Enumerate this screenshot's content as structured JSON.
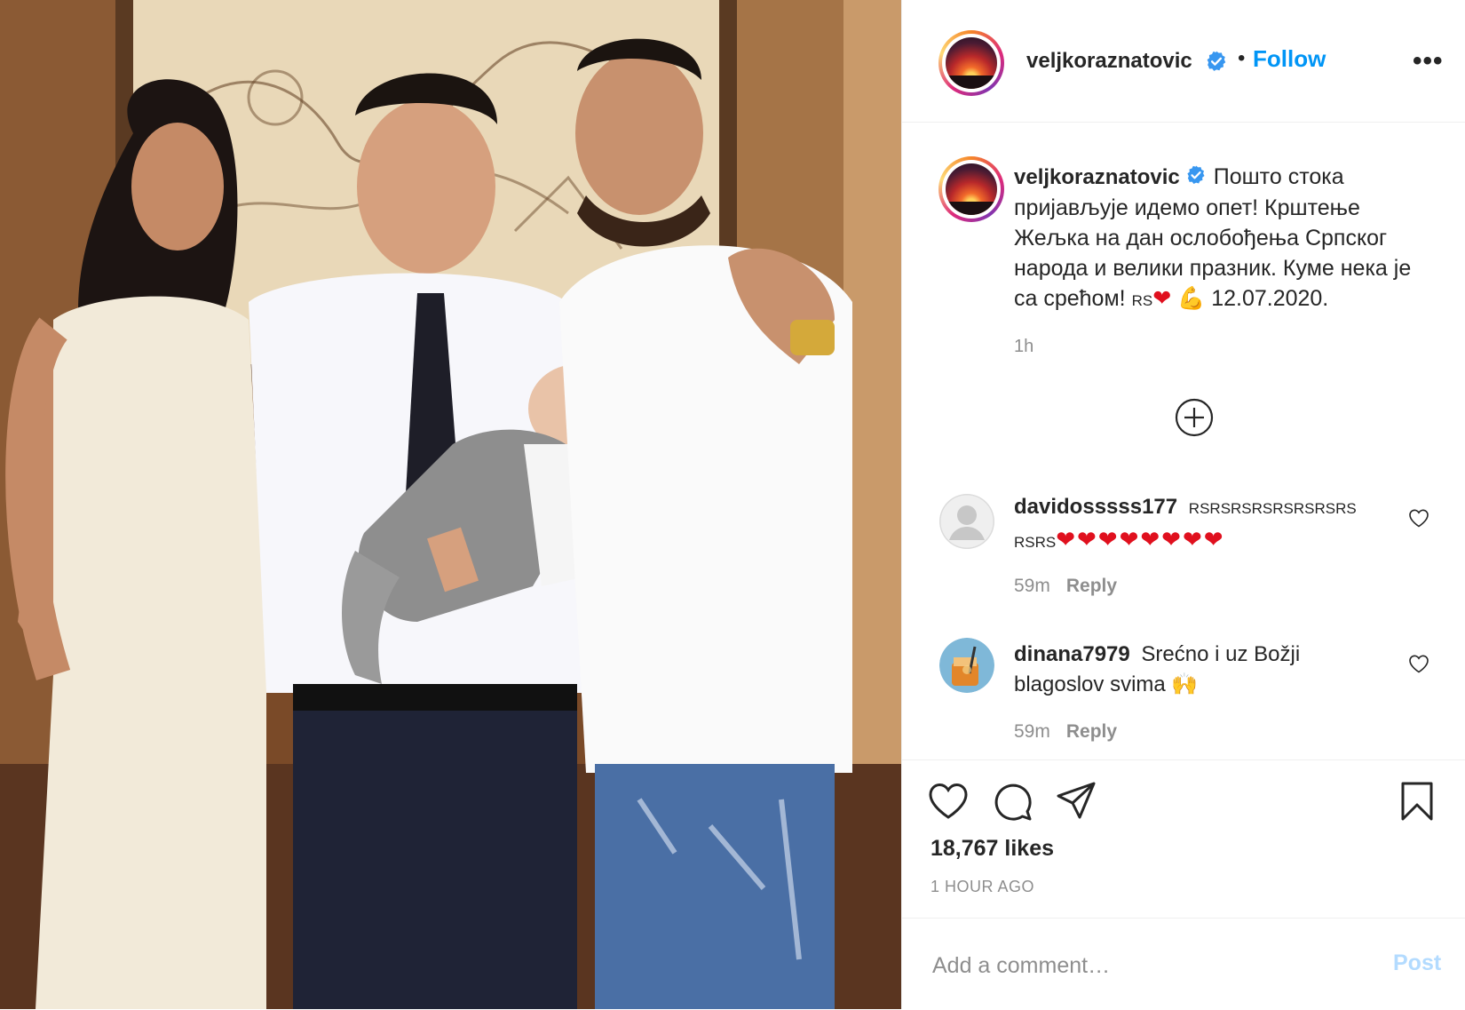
{
  "post": {
    "username": "veljkoraznatovic",
    "follow_label": "Follow",
    "dot_separator": "•",
    "more_label": "•••"
  },
  "caption": {
    "username": "veljkoraznatovic",
    "text": "Пошто стока пријављује идемо опет! Крштење Жељка на дан ослобођења Српског народа и велики празник. Куме нека је са срећом!",
    "flag_label": "RS",
    "emoji_end": "12.07.2020.",
    "time": "1h"
  },
  "comments": [
    {
      "username": "davidosssss177",
      "text_small": "RSRSRSRSRSRSRSRS",
      "text_small2": "RSRS",
      "hearts": "❤❤❤❤❤❤❤❤",
      "time": "59m",
      "reply_label": "Reply"
    },
    {
      "username": "dinana7979",
      "text": "Srećno i uz Božji blagoslov svima",
      "emoji": "🙌",
      "time": "59m",
      "reply_label": "Reply"
    }
  ],
  "actions": {
    "likes": "18,767 likes",
    "time_ago": "1 HOUR AGO"
  },
  "add_comment": {
    "placeholder": "Add a comment…",
    "post_label": "Post"
  },
  "colors": {
    "link_blue": "#0095f6",
    "muted": "#8e8e8e",
    "border": "#efefef",
    "post_disabled": "#b3dbff"
  }
}
